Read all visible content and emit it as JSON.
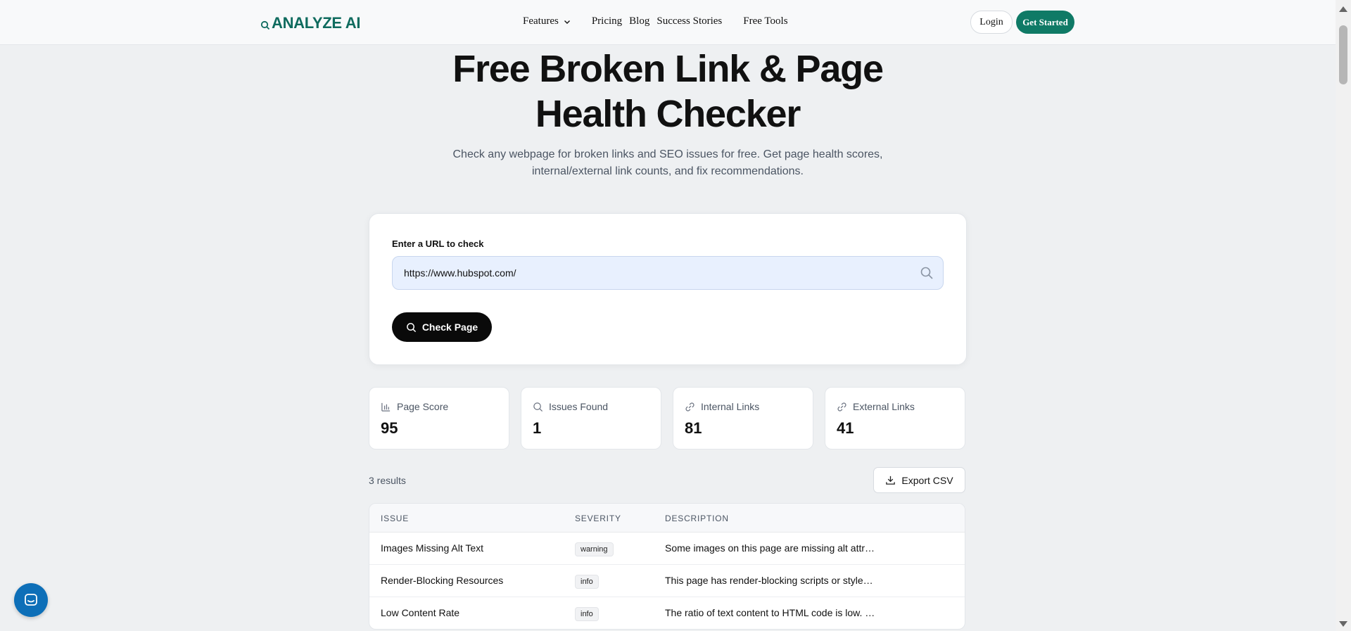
{
  "nav": {
    "logo": "ANALYZE AI",
    "links": [
      {
        "label": "Features",
        "has_dropdown": true
      },
      {
        "label": "Pricing"
      },
      {
        "label": "Blog"
      },
      {
        "label": "Success Stories"
      },
      {
        "label": "Free Tools"
      }
    ],
    "login_label": "Login",
    "get_started_label": "Get Started",
    "accent_color": "#0f7a66"
  },
  "hero": {
    "title_line1": "Free Broken Link & Page",
    "title_line2": "Health Checker",
    "subtitle_line1": "Check any webpage for broken links and SEO issues for free. Get page health scores,",
    "subtitle_line2": "internal/external link counts, and fix recommendations."
  },
  "checker": {
    "label": "Enter a URL to check",
    "url_value": "https://www.hubspot.com/",
    "button_label": "Check Page"
  },
  "stats": [
    {
      "label": "Page Score",
      "value": "95",
      "icon": "bar-chart-icon"
    },
    {
      "label": "Issues Found",
      "value": "1",
      "icon": "search-icon"
    },
    {
      "label": "Internal Links",
      "value": "81",
      "icon": "link-icon"
    },
    {
      "label": "External Links",
      "value": "41",
      "icon": "link-icon"
    }
  ],
  "results": {
    "count_label": "3 results",
    "export_label": "Export CSV",
    "columns": [
      "ISSUE",
      "SEVERITY",
      "DESCRIPTION"
    ],
    "rows": [
      {
        "issue": "Images Missing Alt Text",
        "severity": "warning",
        "description": "Some images on this page are missing alt attr…"
      },
      {
        "issue": "Render-Blocking Resources",
        "severity": "info",
        "description": "This page has render-blocking scripts or style…"
      },
      {
        "issue": "Low Content Rate",
        "severity": "info",
        "description": "The ratio of text content to HTML code is low. …"
      }
    ]
  }
}
